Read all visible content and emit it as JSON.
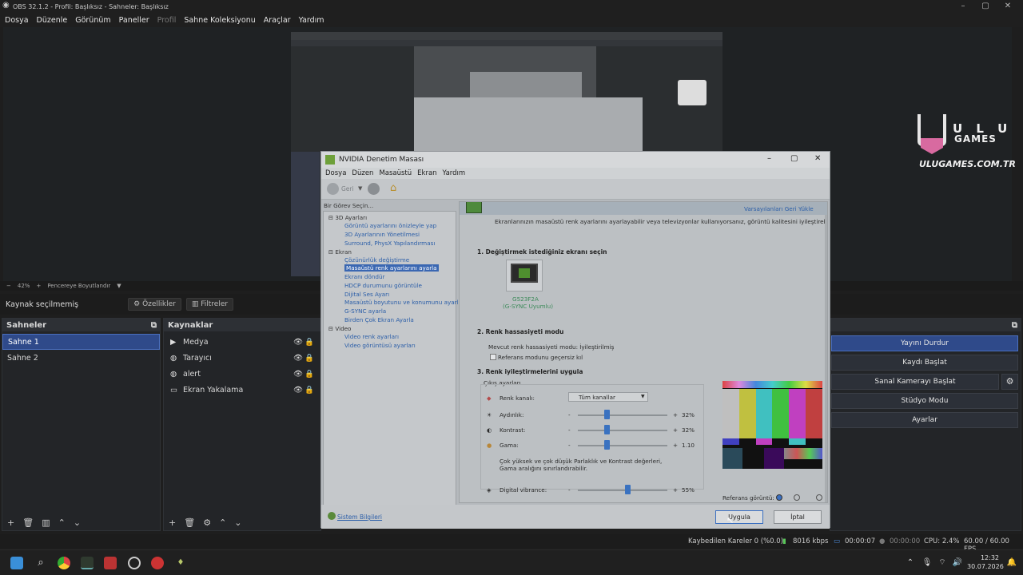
{
  "obs": {
    "title": "OBS 32.1.2 - Profil: Başlıksız - Sahneler: Başlıksız",
    "menu": [
      "Dosya",
      "Düzenle",
      "Görünüm",
      "Paneller",
      "Profil",
      "Sahne Koleksiyonu",
      "Araçlar",
      "Yardım"
    ],
    "preview": {
      "zoom": "42%",
      "fit_label": "Pencereye Boyutlandır"
    },
    "source_bar": {
      "status": "Kaynak seçilmemiş",
      "properties": "Özellikler",
      "filters": "Filtreler"
    },
    "scenes": {
      "title": "Sahneler",
      "items": [
        "Sahne 1",
        "Sahne 2"
      ]
    },
    "sources": {
      "title": "Kaynaklar",
      "items": [
        {
          "label": "Medya",
          "icon": "play-icon"
        },
        {
          "label": "Tarayıcı",
          "icon": "globe-icon"
        },
        {
          "label": "alert",
          "icon": "globe-icon"
        },
        {
          "label": "Ekran Yakalama",
          "icon": "monitor-icon"
        }
      ]
    },
    "controls": {
      "stop_stream": "Yayını Durdur",
      "start_record": "Kaydı Başlat",
      "start_vcam": "Sanal Kamerayı Başlat",
      "studio_mode": "Stüdyo Modu",
      "settings": "Ayarlar"
    },
    "status": {
      "dropped": "Kaybedilen Kareler 0 (%0.0)",
      "bitrate": "8016 kbps",
      "stream_time": "00:00:07",
      "rec_time": "00:00:00",
      "cpu": "CPU: 2.4%",
      "fps": "60.00 / 60.00 FPS"
    },
    "logo": {
      "u_text": "U L U",
      "games": "GAMES",
      "url": "ULUGAMES.COM.TR"
    }
  },
  "taskbar": {
    "time": "12:32",
    "date": "30.07.2026"
  },
  "nvidia": {
    "title": "NVIDIA Denetim Masası",
    "menu": [
      "Dosya",
      "Düzen",
      "Masaüstü",
      "Ekran",
      "Yardım"
    ],
    "back": "Geri",
    "task_label": "Bir Görev Seçin...",
    "tree": {
      "cat_3d": "3D Ayarları",
      "i1": "Görüntü ayarlarını önizleyle yap",
      "i2": "3D Ayarlarının Yönetilmesi",
      "i3": "Surround, PhysX Yapılandırması",
      "cat_display": "Ekran",
      "i4": "Çözünürlük değiştirme",
      "i5": "Masaüstü renk ayarlarını ayarla",
      "i6": "Ekranı döndür",
      "i7": "HDCP durumunu görüntüle",
      "i8": "Dijital Ses Ayarı",
      "i9": "Masaüstü boyutunu ve konumunu ayarla",
      "i10": "G-SYNC ayarla",
      "i11": "Birden Çok Ekran Ayarla",
      "cat_video": "Video",
      "i12": "Video renk ayarları",
      "i13": "Video görüntüsü ayarları"
    },
    "content": {
      "restore": "Varsayılanları Geri Yükle",
      "desc": "Ekranlarınızın masaüstü renk ayarlarını ayarlayabilir veya televizyonlar kullanıyorsanız, görüntü kalitesini iyileştirebilirsiniz.",
      "s1": "1. Değiştirmek istediğiniz ekranı seçin",
      "monitor_name": "G523F2A",
      "monitor_sub": "(G-SYNC Uyumlu)",
      "s2": "2. Renk hassasiyeti modu",
      "precision": "Mevcut renk hassasiyeti modu: İyileştirilmiş",
      "ref_mode": "Referans modunu geçersiz kıl",
      "s3": "3. Renk iyileştirmelerini uygula",
      "output": "Çıkış ayarları",
      "channel_label": "Renk kanalı:",
      "channel_value": "Tüm kanallar",
      "brightness_label": "Aydınlık:",
      "brightness_value": "32%",
      "contrast_label": "Kontrast:",
      "contrast_value": "32%",
      "gamma_label": "Gama:",
      "gamma_value": "1.10",
      "note": "Çok yüksek ve çok düşük Parlaklık ve Kontrast değerleri, Gama aralığını sınırlandırabilir.",
      "vibrance_label": "Digital vibrance:",
      "vibrance_value": "55%",
      "ref_image": "Referans görüntü:",
      "minus": "-",
      "plus": "+"
    },
    "system_info": "Sistem Bilgileri",
    "apply": "Uygula",
    "cancel": "İptal"
  }
}
